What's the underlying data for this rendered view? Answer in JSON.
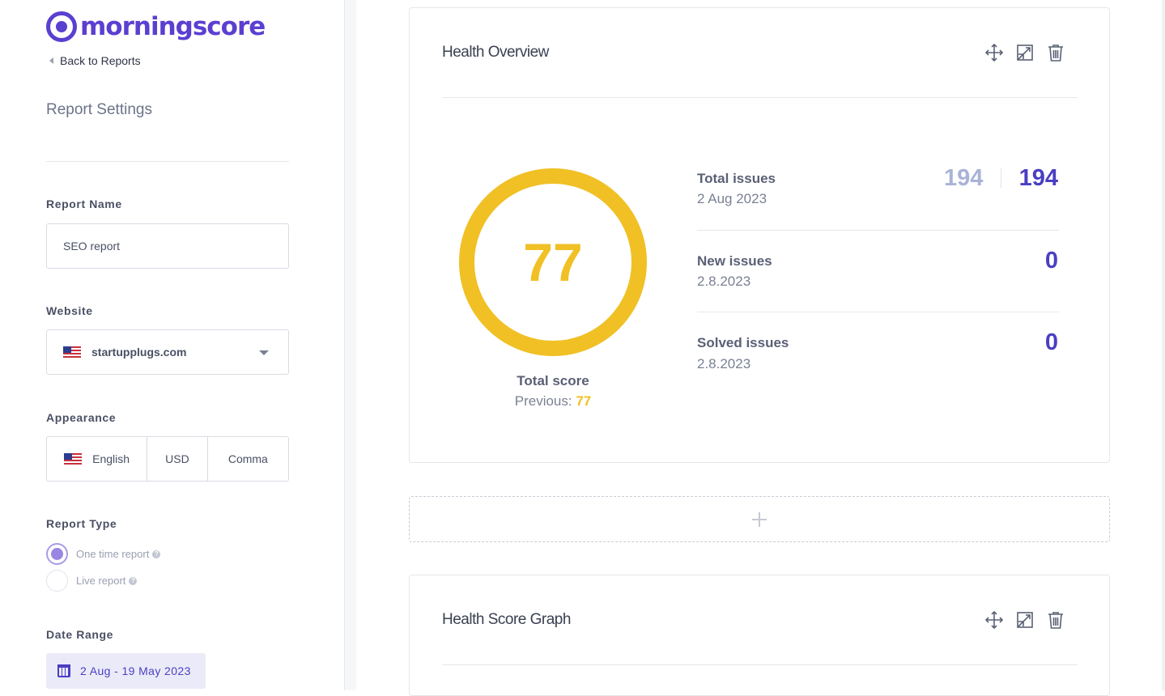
{
  "brand": {
    "name": "morningscore",
    "color": "#5b3fd1"
  },
  "nav": {
    "back_label": "Back to Reports"
  },
  "sidebar": {
    "title": "Report Settings",
    "report_name": {
      "label": "Report Name",
      "value": "SEO report"
    },
    "website": {
      "label": "Website",
      "value": "startupplugs.com",
      "flag_icon": "us-flag-icon"
    },
    "appearance": {
      "label": "Appearance",
      "language": "English",
      "currency": "USD",
      "separator": "Comma"
    },
    "report_type": {
      "label": "Report Type",
      "options": [
        {
          "label": "One time report",
          "selected": true
        },
        {
          "label": "Live report",
          "selected": false
        }
      ]
    },
    "date_range": {
      "label": "Date Range",
      "value": "2 Aug - 19 May 2023"
    }
  },
  "health_overview": {
    "title": "Health Overview",
    "score": "77",
    "score_label": "Total score",
    "previous_label": "Previous:",
    "previous_value": "77",
    "stats": [
      {
        "label": "Total issues",
        "date": "2 Aug 2023",
        "previous": "194",
        "value": "194"
      },
      {
        "label": "New issues",
        "date": "2.8.2023",
        "value": "0"
      },
      {
        "label": "Solved issues",
        "date": "2.8.2023",
        "value": "0"
      }
    ]
  },
  "health_score_graph": {
    "title": "Health Score Graph"
  },
  "icons": {
    "move": "move-icon",
    "resize": "resize-icon",
    "delete": "trash-icon",
    "add": "plus-icon"
  },
  "colors": {
    "accent": "#4a3fc2",
    "score": "#f0c025",
    "muted_value": "#a9b3d6"
  }
}
